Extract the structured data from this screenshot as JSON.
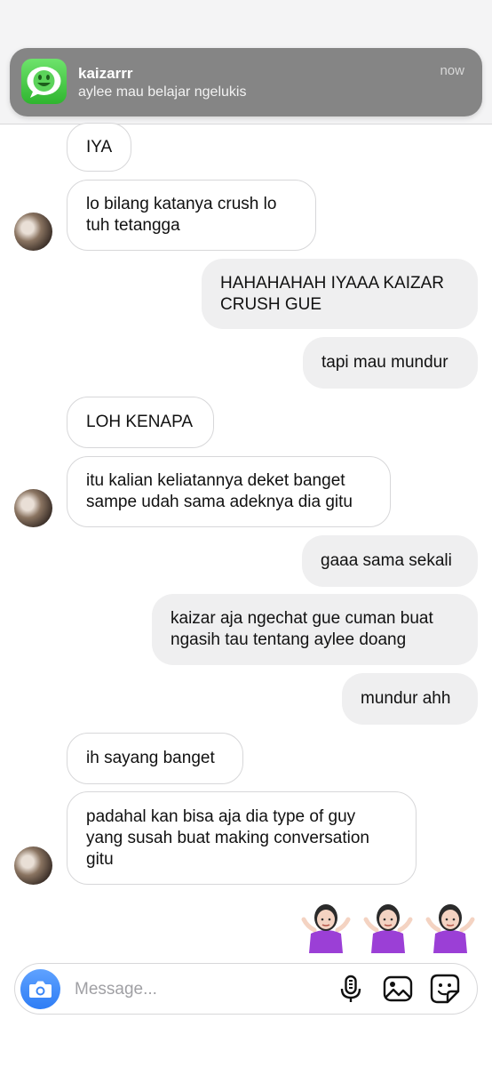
{
  "notification": {
    "sender": "kaizarrr",
    "preview": "aylee mau belajar ngelukis",
    "time": "now"
  },
  "messages": [
    {
      "from": "them",
      "text": "IYA"
    },
    {
      "from": "them",
      "text": "lo bilang katanya crush lo\ntuh tetangga"
    },
    {
      "from": "me",
      "text": "HAHAHAHAH IYAAA KAIZAR\nCRUSH GUE"
    },
    {
      "from": "me",
      "text": "tapi mau mundur"
    },
    {
      "from": "them",
      "text": "LOH KENAPA"
    },
    {
      "from": "them",
      "text": "itu kalian keliatannya deket banget\nsampe udah sama adeknya dia gitu"
    },
    {
      "from": "me",
      "text": "gaaa sama sekali"
    },
    {
      "from": "me",
      "text": "kaizar aja ngechat gue cuman buat\nngasih tau tentang aylee doang"
    },
    {
      "from": "me",
      "text": "mundur ahh"
    },
    {
      "from": "them",
      "text": "ih sayang banget"
    },
    {
      "from": "them",
      "text": "padahal kan bisa aja dia type of guy\nyang susah buat making conversation\ngitu"
    }
  ],
  "reaction_emojis": [
    "shrug-woman-emoji",
    "shrug-woman-emoji",
    "shrug-woman-emoji"
  ],
  "composer": {
    "placeholder": "Message..."
  },
  "colors": {
    "incoming_bubble": "#ffffff",
    "outgoing_bubble": "#efeff0",
    "notification_bg": "#858585",
    "accent_blue": "#2e7df5",
    "app_icon_green": "#2fb52f"
  }
}
